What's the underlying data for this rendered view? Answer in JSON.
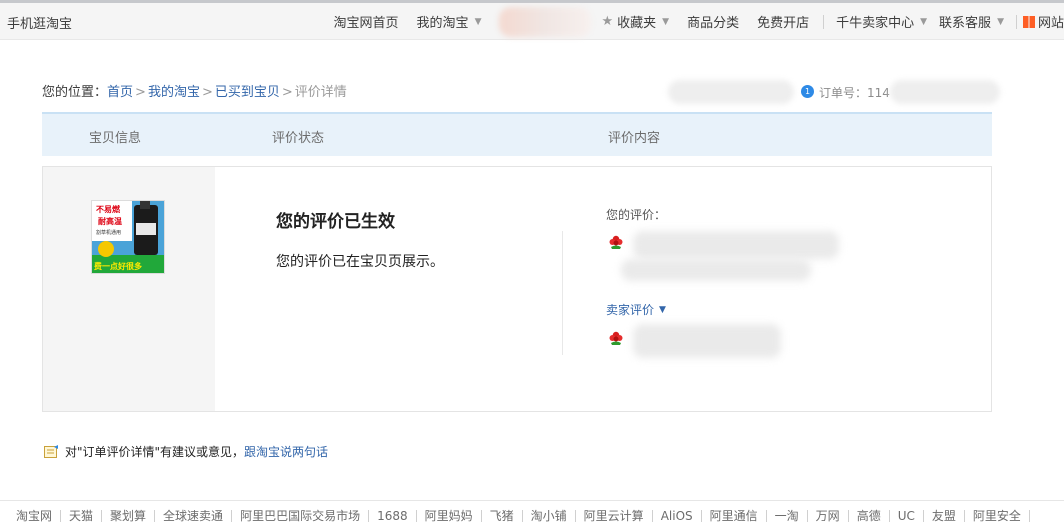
{
  "topbar": {
    "left": "手机逛淘宝",
    "home": "淘宝网首页",
    "my_taobao": "我的淘宝",
    "favorites": "收藏夹",
    "categories": "商品分类",
    "open_store": "免费开店",
    "seller_center": "千牛卖家中心",
    "service": "联系客服",
    "sitemap": "网站"
  },
  "breadcrumb": {
    "prefix": "您的位置：",
    "home": "首页",
    "my_taobao": "我的淘宝",
    "bought": "已买到宝贝",
    "current": "评价详情",
    "separator": ">"
  },
  "order": {
    "label": "订单号：114",
    "badge": "1"
  },
  "table_header": {
    "item": "宝贝信息",
    "status": "评价状态",
    "content": "评价内容"
  },
  "product": {
    "thumb_text_top": "不易燃",
    "thumb_text_mid": "耐高温",
    "thumb_text_small": "割草机通用",
    "thumb_text_bottom": "费一点好很多"
  },
  "status": {
    "title": "您的评价已生效",
    "text": "您的评价已在宝贝页展示。"
  },
  "review": {
    "your_label": "您的评价：",
    "seller_label": "卖家评价",
    "flower_icon": "red-flower-icon"
  },
  "feedback": {
    "text": "对\"订单评价详情\"有建议或意见，",
    "link": "跟淘宝说两句话"
  },
  "footer": {
    "links": [
      "淘宝网",
      "天猫",
      "聚划算",
      "全球速卖通",
      "阿里巴巴国际交易市场",
      "1688",
      "阿里妈妈",
      "飞猪",
      "淘小铺",
      "阿里云计算",
      "AliOS",
      "阿里通信",
      "一淘",
      "万网",
      "高德",
      "UC",
      "友盟",
      "阿里安全"
    ]
  },
  "colors": {
    "link": "#3366aa",
    "header_bg": "#e8f2fa",
    "accent": "#ff4400"
  }
}
